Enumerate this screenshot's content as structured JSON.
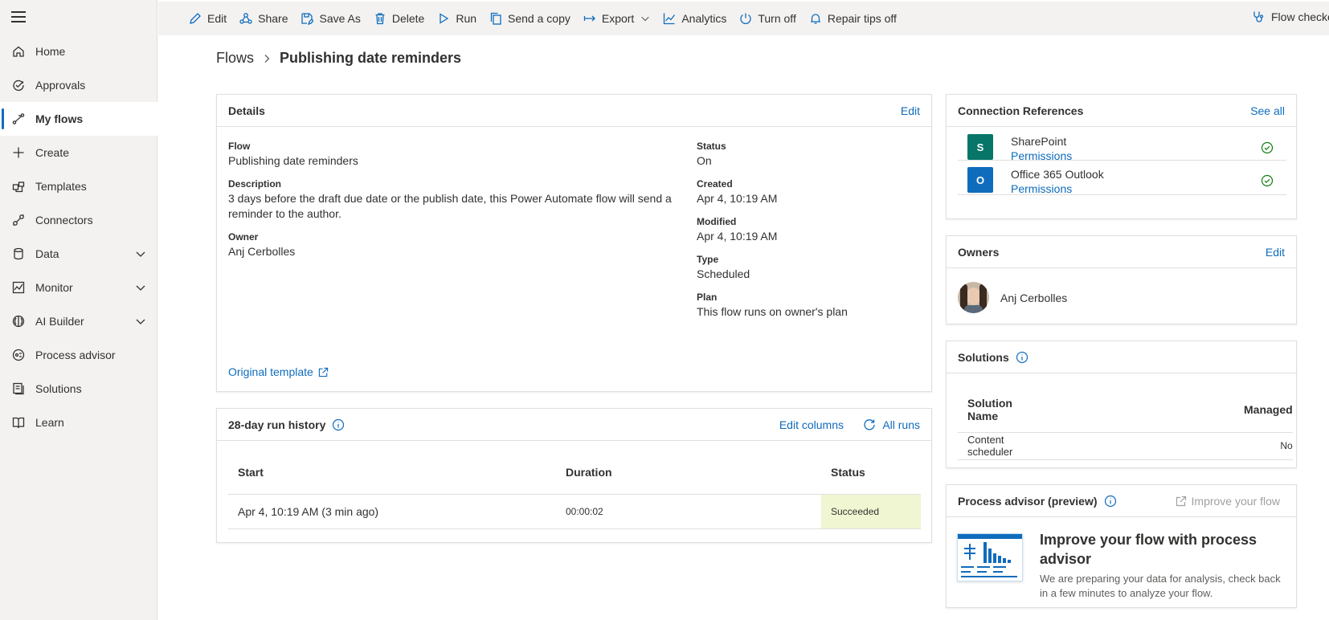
{
  "nav": {
    "items": [
      {
        "label": "Home",
        "icon": "home-icon"
      },
      {
        "label": "Approvals",
        "icon": "approvals-icon"
      },
      {
        "label": "My flows",
        "icon": "flows-icon"
      },
      {
        "label": "Create",
        "icon": "plus-icon"
      },
      {
        "label": "Templates",
        "icon": "templates-icon"
      },
      {
        "label": "Connectors",
        "icon": "connectors-icon"
      },
      {
        "label": "Data",
        "icon": "database-icon"
      },
      {
        "label": "Monitor",
        "icon": "monitor-icon"
      },
      {
        "label": "AI Builder",
        "icon": "ai-builder-icon"
      },
      {
        "label": "Process advisor",
        "icon": "process-advisor-icon"
      },
      {
        "label": "Solutions",
        "icon": "solutions-icon"
      },
      {
        "label": "Learn",
        "icon": "learn-icon"
      }
    ],
    "active": "My flows"
  },
  "commands": {
    "edit": "Edit",
    "share": "Share",
    "save_as": "Save As",
    "delete": "Delete",
    "run": "Run",
    "send_copy": "Send a copy",
    "export": "Export",
    "analytics": "Analytics",
    "turn_off": "Turn off",
    "repair_tips": "Repair tips off",
    "flow_checker": "Flow checker"
  },
  "breadcrumb": {
    "parent": "Flows",
    "current": "Publishing date reminders"
  },
  "details": {
    "title": "Details",
    "edit_label": "Edit",
    "flow_label": "Flow",
    "flow_value": "Publishing date reminders",
    "description_label": "Description",
    "description_value": "3 days before the draft due date or the publish date, this Power Automate flow will send a reminder to the author.",
    "owner_label": "Owner",
    "owner_value": "Anj Cerbolles",
    "status_label": "Status",
    "status_value": "On",
    "created_label": "Created",
    "created_value": "Apr 4, 10:19 AM",
    "modified_label": "Modified",
    "modified_value": "Apr 4, 10:19 AM",
    "type_label": "Type",
    "type_value": "Scheduled",
    "plan_label": "Plan",
    "plan_value": "This flow runs on owner's plan",
    "template_link": "Original template"
  },
  "run_history": {
    "title": "28-day run history",
    "edit_columns": "Edit columns",
    "all_runs": "All runs",
    "columns": [
      "Start",
      "Duration",
      "Status"
    ],
    "rows": [
      {
        "start": "Apr 4, 10:19 AM (3 min ago)",
        "duration": "00:00:02",
        "status": "Succeeded"
      }
    ],
    "status_color": "#f0f6d2"
  },
  "connections": {
    "title": "Connection References",
    "see_all": "See all",
    "items": [
      {
        "name": "SharePoint",
        "link": "Permissions",
        "color": "#077568",
        "badge": "S"
      },
      {
        "name": "Office 365 Outlook",
        "link": "Permissions",
        "color": "#0f6cbd",
        "badge": "O"
      }
    ]
  },
  "owners": {
    "title": "Owners",
    "edit_label": "Edit",
    "name": "Anj Cerbolles"
  },
  "solutions": {
    "title": "Solutions",
    "columns": [
      "Solution Name",
      "Managed"
    ],
    "rows": [
      {
        "name": "Content scheduler",
        "managed": "No"
      }
    ]
  },
  "process_advisor": {
    "title": "Process advisor (preview)",
    "improve_link": "Improve your flow",
    "heading": "Improve your flow with process advisor",
    "body": "We are preparing your data for analysis, check back in a few minutes to analyze your flow."
  },
  "colors": {
    "accent": "#0f6cbd",
    "success": "#107c10"
  }
}
